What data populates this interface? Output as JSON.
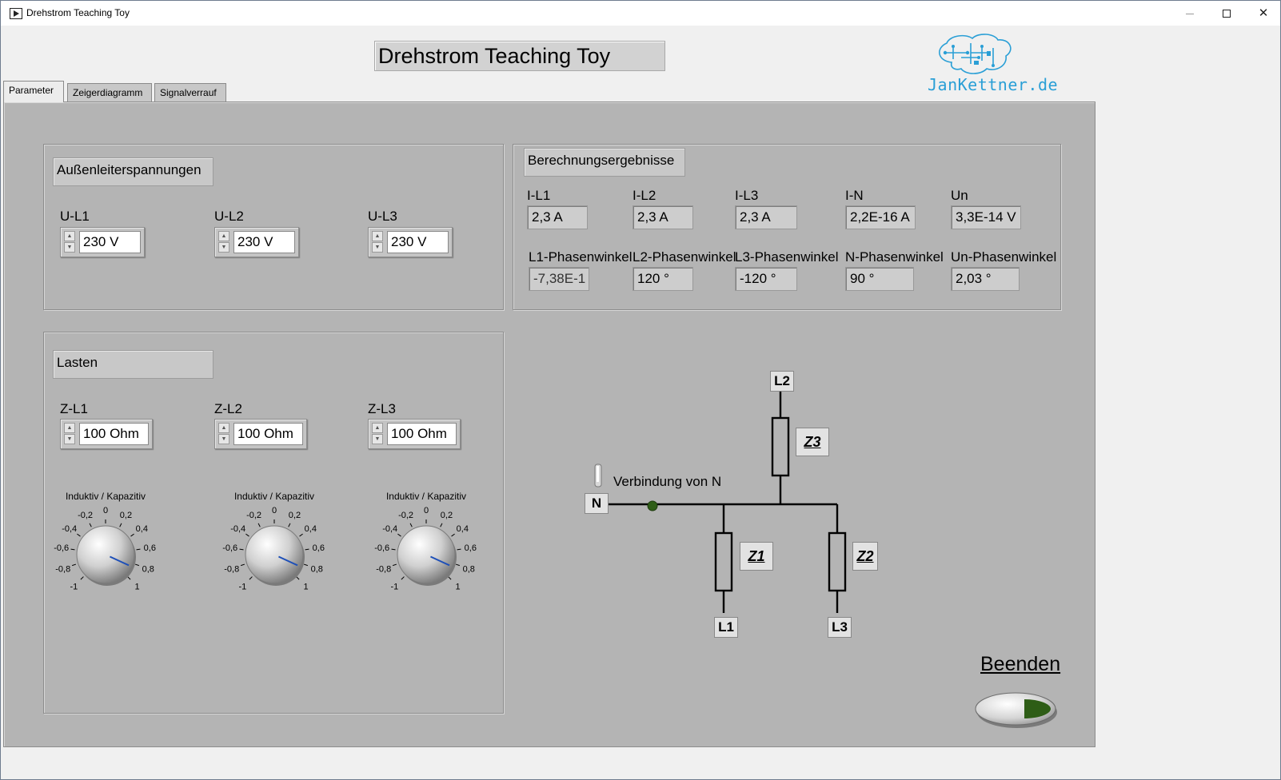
{
  "window": {
    "title": "Drehstrom Teaching Toy",
    "min_icon": "minimize-icon",
    "max_icon": "maximize-icon",
    "close_icon": "close-icon",
    "close_glyph": "✕"
  },
  "header": {
    "title": "Drehstrom Teaching Toy",
    "logo_text": "JanKettner.de"
  },
  "tabs": [
    {
      "label": "Parameter",
      "active": true
    },
    {
      "label": "Zeigerdiagramm",
      "active": false
    },
    {
      "label": "Signalverrauf",
      "active": false
    }
  ],
  "voltages": {
    "title": "Außenleiterspannungen",
    "items": [
      {
        "label": "U-L1",
        "value": "230 V"
      },
      {
        "label": "U-L2",
        "value": "230 V"
      },
      {
        "label": "U-L3",
        "value": "230 V"
      }
    ]
  },
  "results": {
    "title": "Berechnungsergebnisse",
    "currents": [
      {
        "label": "I-L1",
        "value": "2,3  A"
      },
      {
        "label": "I-L2",
        "value": "2,3  A"
      },
      {
        "label": "I-L3",
        "value": "2,3  A"
      },
      {
        "label": "I-N",
        "value": "2,2E-16  A"
      },
      {
        "label": "Un",
        "value": "3,3E-14 V"
      }
    ],
    "angles": [
      {
        "label": "L1-Phasenwinkel",
        "value": "-7,38E-1"
      },
      {
        "label": "L2-Phasenwinkel",
        "value": "120 °"
      },
      {
        "label": "L3-Phasenwinkel",
        "value": "-120 °"
      },
      {
        "label": "N-Phasenwinkel",
        "value": "90 °"
      },
      {
        "label": "Un-Phasenwinkel",
        "value": "2,03 °"
      }
    ]
  },
  "loads": {
    "title": "Lasten",
    "items": [
      {
        "label": "Z-L1",
        "value": "100 Ohm"
      },
      {
        "label": "Z-L2",
        "value": "100 Ohm"
      },
      {
        "label": "Z-L3",
        "value": "100 Ohm"
      }
    ],
    "knob_title": "Induktiv / Kapazitiv",
    "knob_values": [
      0.85,
      0.85,
      0.85
    ],
    "scale_labels": [
      "-1",
      "-0,8",
      "-0,6",
      "-0,4",
      "-0,2",
      "0",
      "0,2",
      "0,4",
      "0,6",
      "0,8",
      "1"
    ]
  },
  "circuit": {
    "node_l2": "L2",
    "node_n": "N",
    "node_l1": "L1",
    "node_l3": "L3",
    "z1": "Z1",
    "z2": "Z2",
    "z3": "Z3",
    "switch_label": "Verbindung von N"
  },
  "quit": {
    "label": "Beenden"
  },
  "colors": {
    "panel": "#b4b4b4",
    "logo": "#2a9fd6",
    "led": "#2e5d16",
    "knob_needle": "#1d4fb8"
  }
}
